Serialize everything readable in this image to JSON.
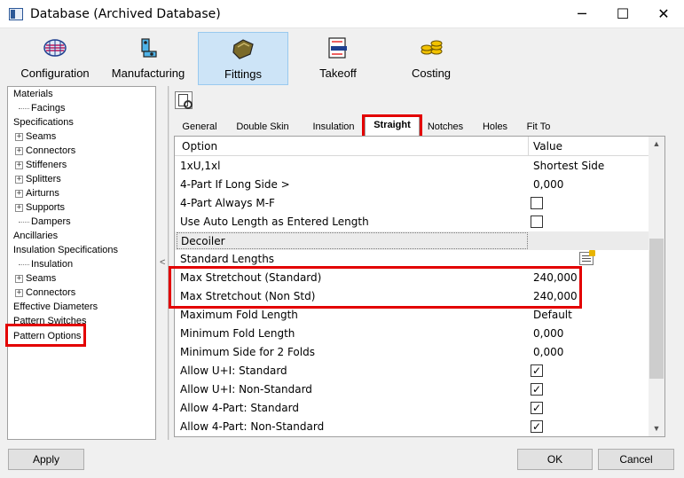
{
  "window": {
    "title": "Database (Archived Database)",
    "minimize_glyph": "─",
    "maximize_glyph": "☐",
    "close_glyph": "✕"
  },
  "ribbon": {
    "tabs": [
      {
        "label": "Configuration",
        "icon": "configuration-icon"
      },
      {
        "label": "Manufacturing",
        "icon": "manufacturing-icon"
      },
      {
        "label": "Fittings",
        "icon": "fittings-icon",
        "active": true
      },
      {
        "label": "Takeoff",
        "icon": "takeoff-icon"
      },
      {
        "label": "Costing",
        "icon": "costing-icon"
      }
    ]
  },
  "tree": {
    "items": [
      {
        "label": "Materials"
      },
      {
        "label": "Facings"
      },
      {
        "label": "Specifications"
      },
      {
        "label": "Seams"
      },
      {
        "label": "Connectors"
      },
      {
        "label": "Stiffeners"
      },
      {
        "label": "Splitters"
      },
      {
        "label": "Airturns"
      },
      {
        "label": "Supports"
      },
      {
        "label": "Dampers"
      },
      {
        "label": "Ancillaries"
      },
      {
        "label": "Insulation Specifications"
      },
      {
        "label": "Insulation"
      },
      {
        "label": "Seams"
      },
      {
        "label": "Connectors"
      },
      {
        "label": "Effective Diameters"
      },
      {
        "label": "Pattern Switches"
      },
      {
        "label": "Pattern Options"
      }
    ],
    "expand_glyph": "+"
  },
  "splitter_glyph": "<",
  "subtabs": [
    "General",
    "Double Skin",
    "Insulation",
    "Straight",
    "Notches",
    "Holes",
    "Fit To"
  ],
  "active_subtab": "Straight",
  "grid": {
    "header": {
      "option": "Option",
      "value": "Value"
    },
    "rows": [
      {
        "option": "1xU,1xl",
        "value": "Shortest Side"
      },
      {
        "option": "4-Part If Long Side >",
        "value": "0,000"
      },
      {
        "option": "4-Part Always M-F",
        "checkbox": false
      },
      {
        "option": "Use Auto Length as Entered Length",
        "checkbox": false
      },
      {
        "option": "Decoiler",
        "section": true
      },
      {
        "option": "Standard Lengths",
        "icon": "list-edit-icon"
      },
      {
        "option": "Max Stretchout (Standard)",
        "value": "240,000"
      },
      {
        "option": "Max Stretchout (Non Std)",
        "value": "240,000"
      },
      {
        "option": "Maximum Fold Length",
        "value": "Default"
      },
      {
        "option": "Minimum Fold Length",
        "value": "0,000"
      },
      {
        "option": "Minimum Side for 2 Folds",
        "value": "0,000"
      },
      {
        "option": "Allow U+I: Standard",
        "checkbox": true
      },
      {
        "option": "Allow U+I: Non-Standard",
        "checkbox": true
      },
      {
        "option": "Allow 4-Part: Standard",
        "checkbox": true
      },
      {
        "option": "Allow 4-Part: Non-Standard",
        "checkbox": true
      }
    ],
    "check_glyph": "✓",
    "scroll_up_glyph": "▲",
    "scroll_down_glyph": "▼"
  },
  "buttons": {
    "apply": "Apply",
    "ok": "OK",
    "cancel": "Cancel"
  },
  "colors": {
    "highlight": "#e30000",
    "active_tab": "#cde4f7"
  }
}
